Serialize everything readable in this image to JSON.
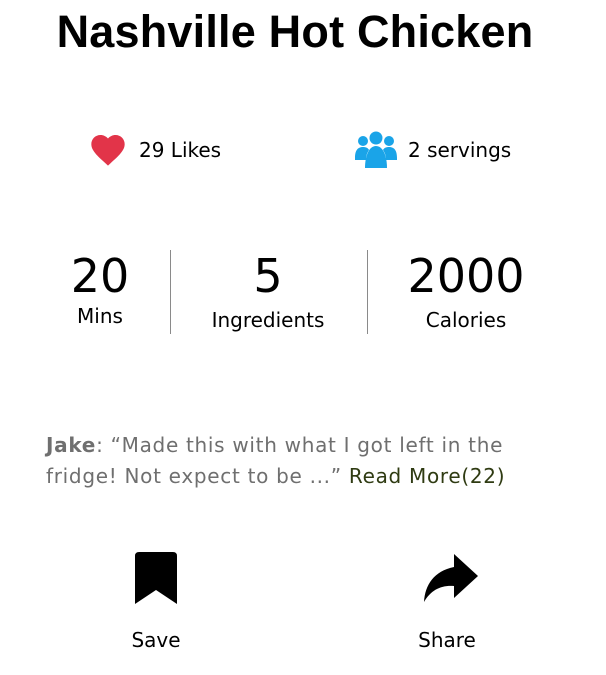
{
  "recipe": {
    "title": "Nashville Hot Chicken"
  },
  "stats": {
    "likes": {
      "icon": "heart-icon",
      "label": "29 Likes",
      "color": "#e23449"
    },
    "servings": {
      "icon": "users-icon",
      "label": "2 servings",
      "color": "#1aa4e8"
    }
  },
  "metrics": [
    {
      "value": "20",
      "unit": "Mins"
    },
    {
      "value": "5",
      "unit": "Ingredients"
    },
    {
      "value": "2000",
      "unit": "Calories"
    }
  ],
  "comment": {
    "author": "Jake",
    "text_prefix": ": “Made this with what I got left in the fridge! Not expect to be ...”",
    "read_more": "Read More(22)"
  },
  "actions": {
    "save": {
      "icon": "bookmark-icon",
      "label": "Save"
    },
    "share": {
      "icon": "share-arrow-icon",
      "label": "Share"
    }
  }
}
